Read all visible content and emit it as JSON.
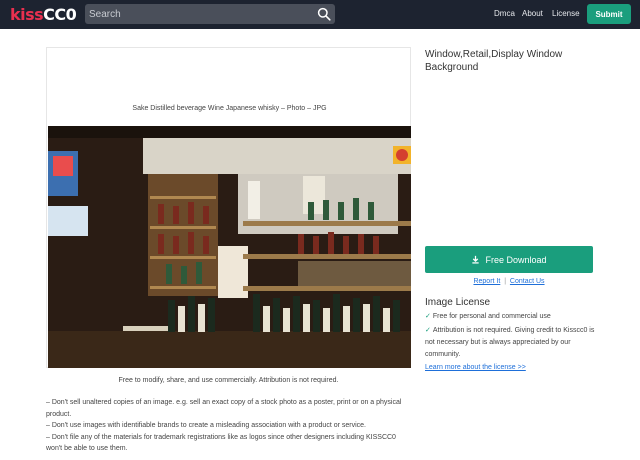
{
  "header": {
    "logo_part1": "kiss",
    "logo_part2": "CC0",
    "search_placeholder": "Search",
    "nav": [
      "Dmca",
      "About",
      "License"
    ],
    "submit_label": "Submit"
  },
  "photo": {
    "title": "Sake Distilled beverage Wine Japanese whisky – Photo – JPG",
    "caption": "Free to modify, share, and use commercially. Attribution is not required."
  },
  "terms": [
    "– Don't sell unaltered copies of an image. e.g. sell an exact copy of a stock photo as a poster, print or on a physical product.",
    "– Don't use images with identifiable brands to create a misleading association with a product or service.",
    "– Don't file any of the materials for trademark registrations like as logos since other designers including KISSCC0 won't be able to use them."
  ],
  "sidebar": {
    "title": "Window,Retail,Display Window Background",
    "download_label": "Free Download",
    "report_label": "Report It",
    "separator": "|",
    "contact_label": "Contact Us",
    "license_heading": "Image License",
    "license_items": [
      "Free for personal and commercial use",
      "Attribution is not required. Giving credit to Kisscc0 is not necessary but is always appreciated by our community."
    ],
    "learn_more": "Learn more about the license >>"
  },
  "colors": {
    "header_bg": "#1d2330",
    "accent": "#1a9e7d",
    "logo_red": "#e8304f",
    "link": "#1e6fd9"
  }
}
